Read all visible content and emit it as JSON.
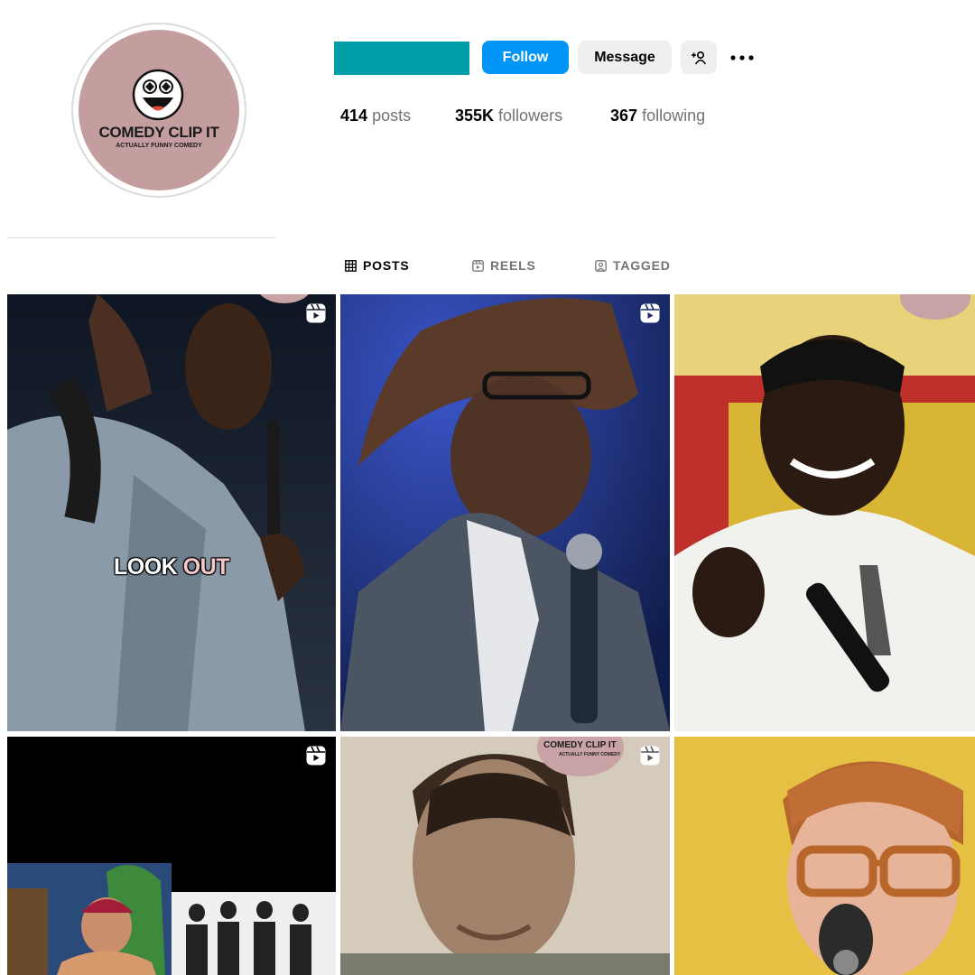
{
  "profile": {
    "avatar": {
      "icon": "comedy-face-logo",
      "brand_title": "COMEDY CLIP IT",
      "brand_subtitle": "ACTUALLY FUNNY COMEDY",
      "bg_color": "#c49e9f"
    },
    "username_redaction_color": "#009ea8",
    "buttons": {
      "follow": "Follow",
      "message": "Message",
      "add_user_icon": "add-user-icon",
      "more_icon": "more-options-icon"
    },
    "stats": {
      "posts_count": "414",
      "posts_label": "posts",
      "followers_count": "355K",
      "followers_label": "followers",
      "following_count": "367",
      "following_label": "following"
    }
  },
  "tabs": [
    {
      "label": "POSTS",
      "icon": "grid-icon",
      "active": true
    },
    {
      "label": "REELS",
      "icon": "reels-icon",
      "active": false
    },
    {
      "label": "TAGGED",
      "icon": "tagged-icon",
      "active": false
    }
  ],
  "grid": {
    "reel_icon": "reel-icon",
    "tiles": [
      {
        "caption_part1": "LOOK",
        "caption_part2": "OUT"
      },
      {},
      {},
      {},
      {
        "watermark_title": "COMEDY CLIP IT",
        "watermark_sub": "ACTUALLY FUNNY COMEDY"
      },
      {}
    ]
  },
  "colors": {
    "follow_blue": "#0095f6",
    "caption_accent": "#f6c8cb",
    "muted_text": "#737373"
  }
}
